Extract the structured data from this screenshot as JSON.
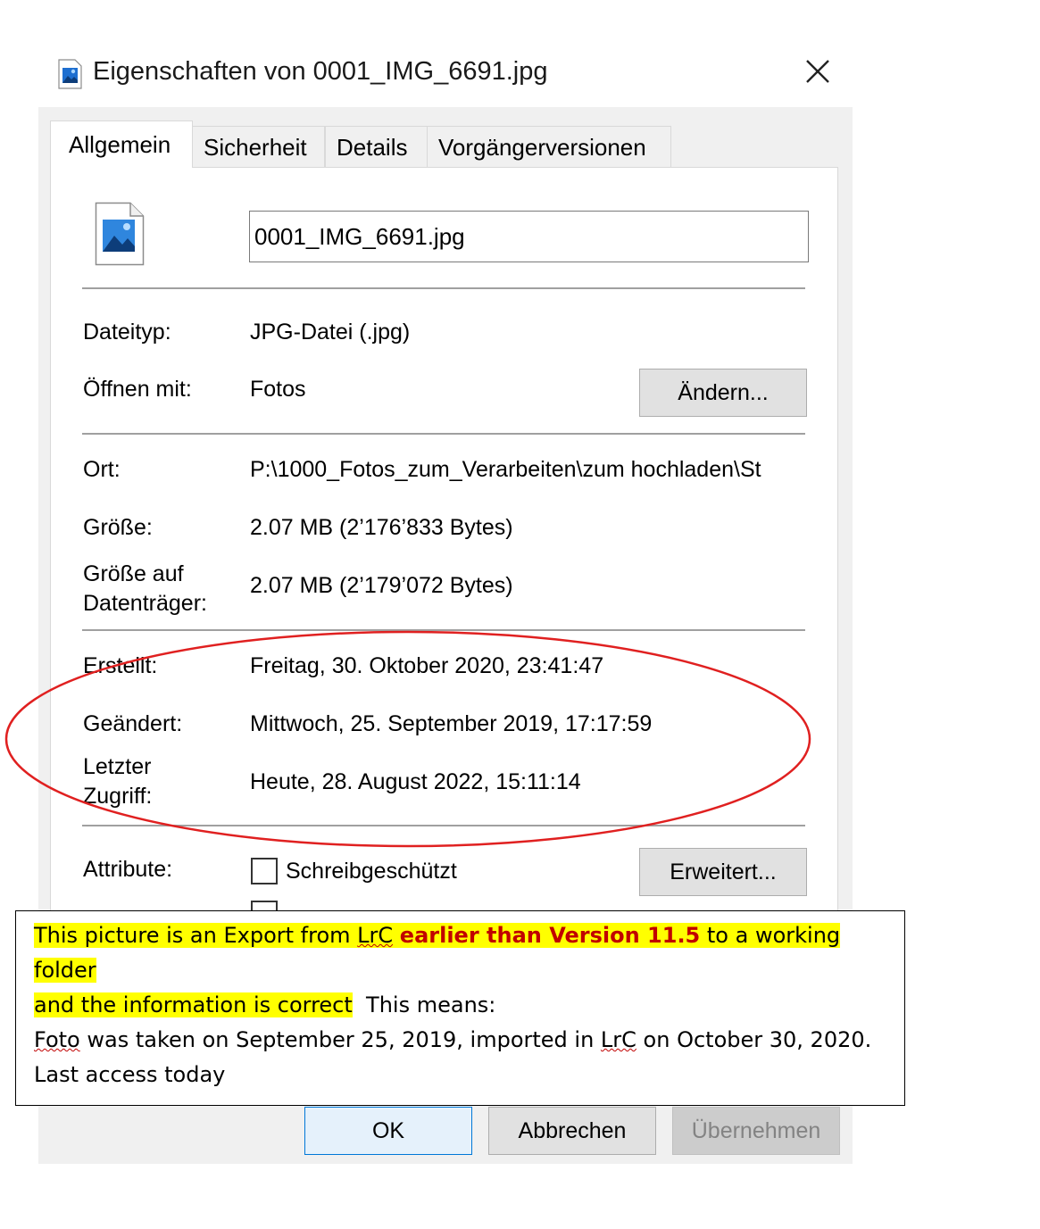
{
  "window": {
    "title": "Eigenschaften von 0001_IMG_6691.jpg",
    "title_icon": "image-file-icon",
    "close_icon": "close-icon"
  },
  "tabs": [
    {
      "label": "Allgemein",
      "active": true
    },
    {
      "label": "Sicherheit",
      "active": false
    },
    {
      "label": "Details",
      "active": false
    },
    {
      "label": "Vorgängerversionen",
      "active": false
    }
  ],
  "general": {
    "file_icon": "image-file-icon",
    "filename": "0001_IMG_6691.jpg",
    "dateityp_label": "Dateityp:",
    "dateityp_value": "JPG-Datei (.jpg)",
    "oeffnen_label": "Öffnen mit:",
    "oeffnen_value": "Fotos",
    "aendern_button": "Ändern...",
    "ort_label": "Ort:",
    "ort_value": "P:\\1000_Fotos_zum_Verarbeiten\\zum hochladen\\St",
    "groesse_label": "Größe:",
    "groesse_value": "2.07 MB (2’176’833 Bytes)",
    "groesse_disk_label_1": "Größe auf",
    "groesse_disk_label_2": "Datenträger:",
    "groesse_disk_value": "2.07 MB (2’179’072 Bytes)",
    "erstellt_label": "Erstellt:",
    "erstellt_value": "Freitag, 30. Oktober 2020, 23:41:47",
    "geaendert_label": "Geändert:",
    "geaendert_value": "Mittwoch, 25. September 2019, 17:17:59",
    "zugriff_label_1": "Letzter",
    "zugriff_label_2": "Zugriff:",
    "zugriff_value": "Heute, 28. August 2022, 15:11:14",
    "attribute_label": "Attribute:",
    "readonly_label": "Schreibgeschützt",
    "readonly_checked": false,
    "erweitert_button": "Erweitert..."
  },
  "annotation": {
    "part1": "This picture is an Export from ",
    "lrc1": "LrC",
    "part2_bold": "earlier than Version 11.5",
    "part3": " to a working folder",
    "part4": "and the information is correct",
    "part5": "  This means:",
    "foto": "Foto",
    "line3_rest_a": " was taken on September 25, 2019, imported in ",
    "lrc2": "LrC",
    "line3_rest_b": " on October 30, 2020.",
    "line4": "Last access today",
    "highlight_color": "#ffff00",
    "emphasis_color": "#c00000",
    "ellipse_color": "#e02020"
  },
  "buttons": {
    "ok": "OK",
    "cancel": "Abbrechen",
    "apply": "Übernehmen"
  }
}
